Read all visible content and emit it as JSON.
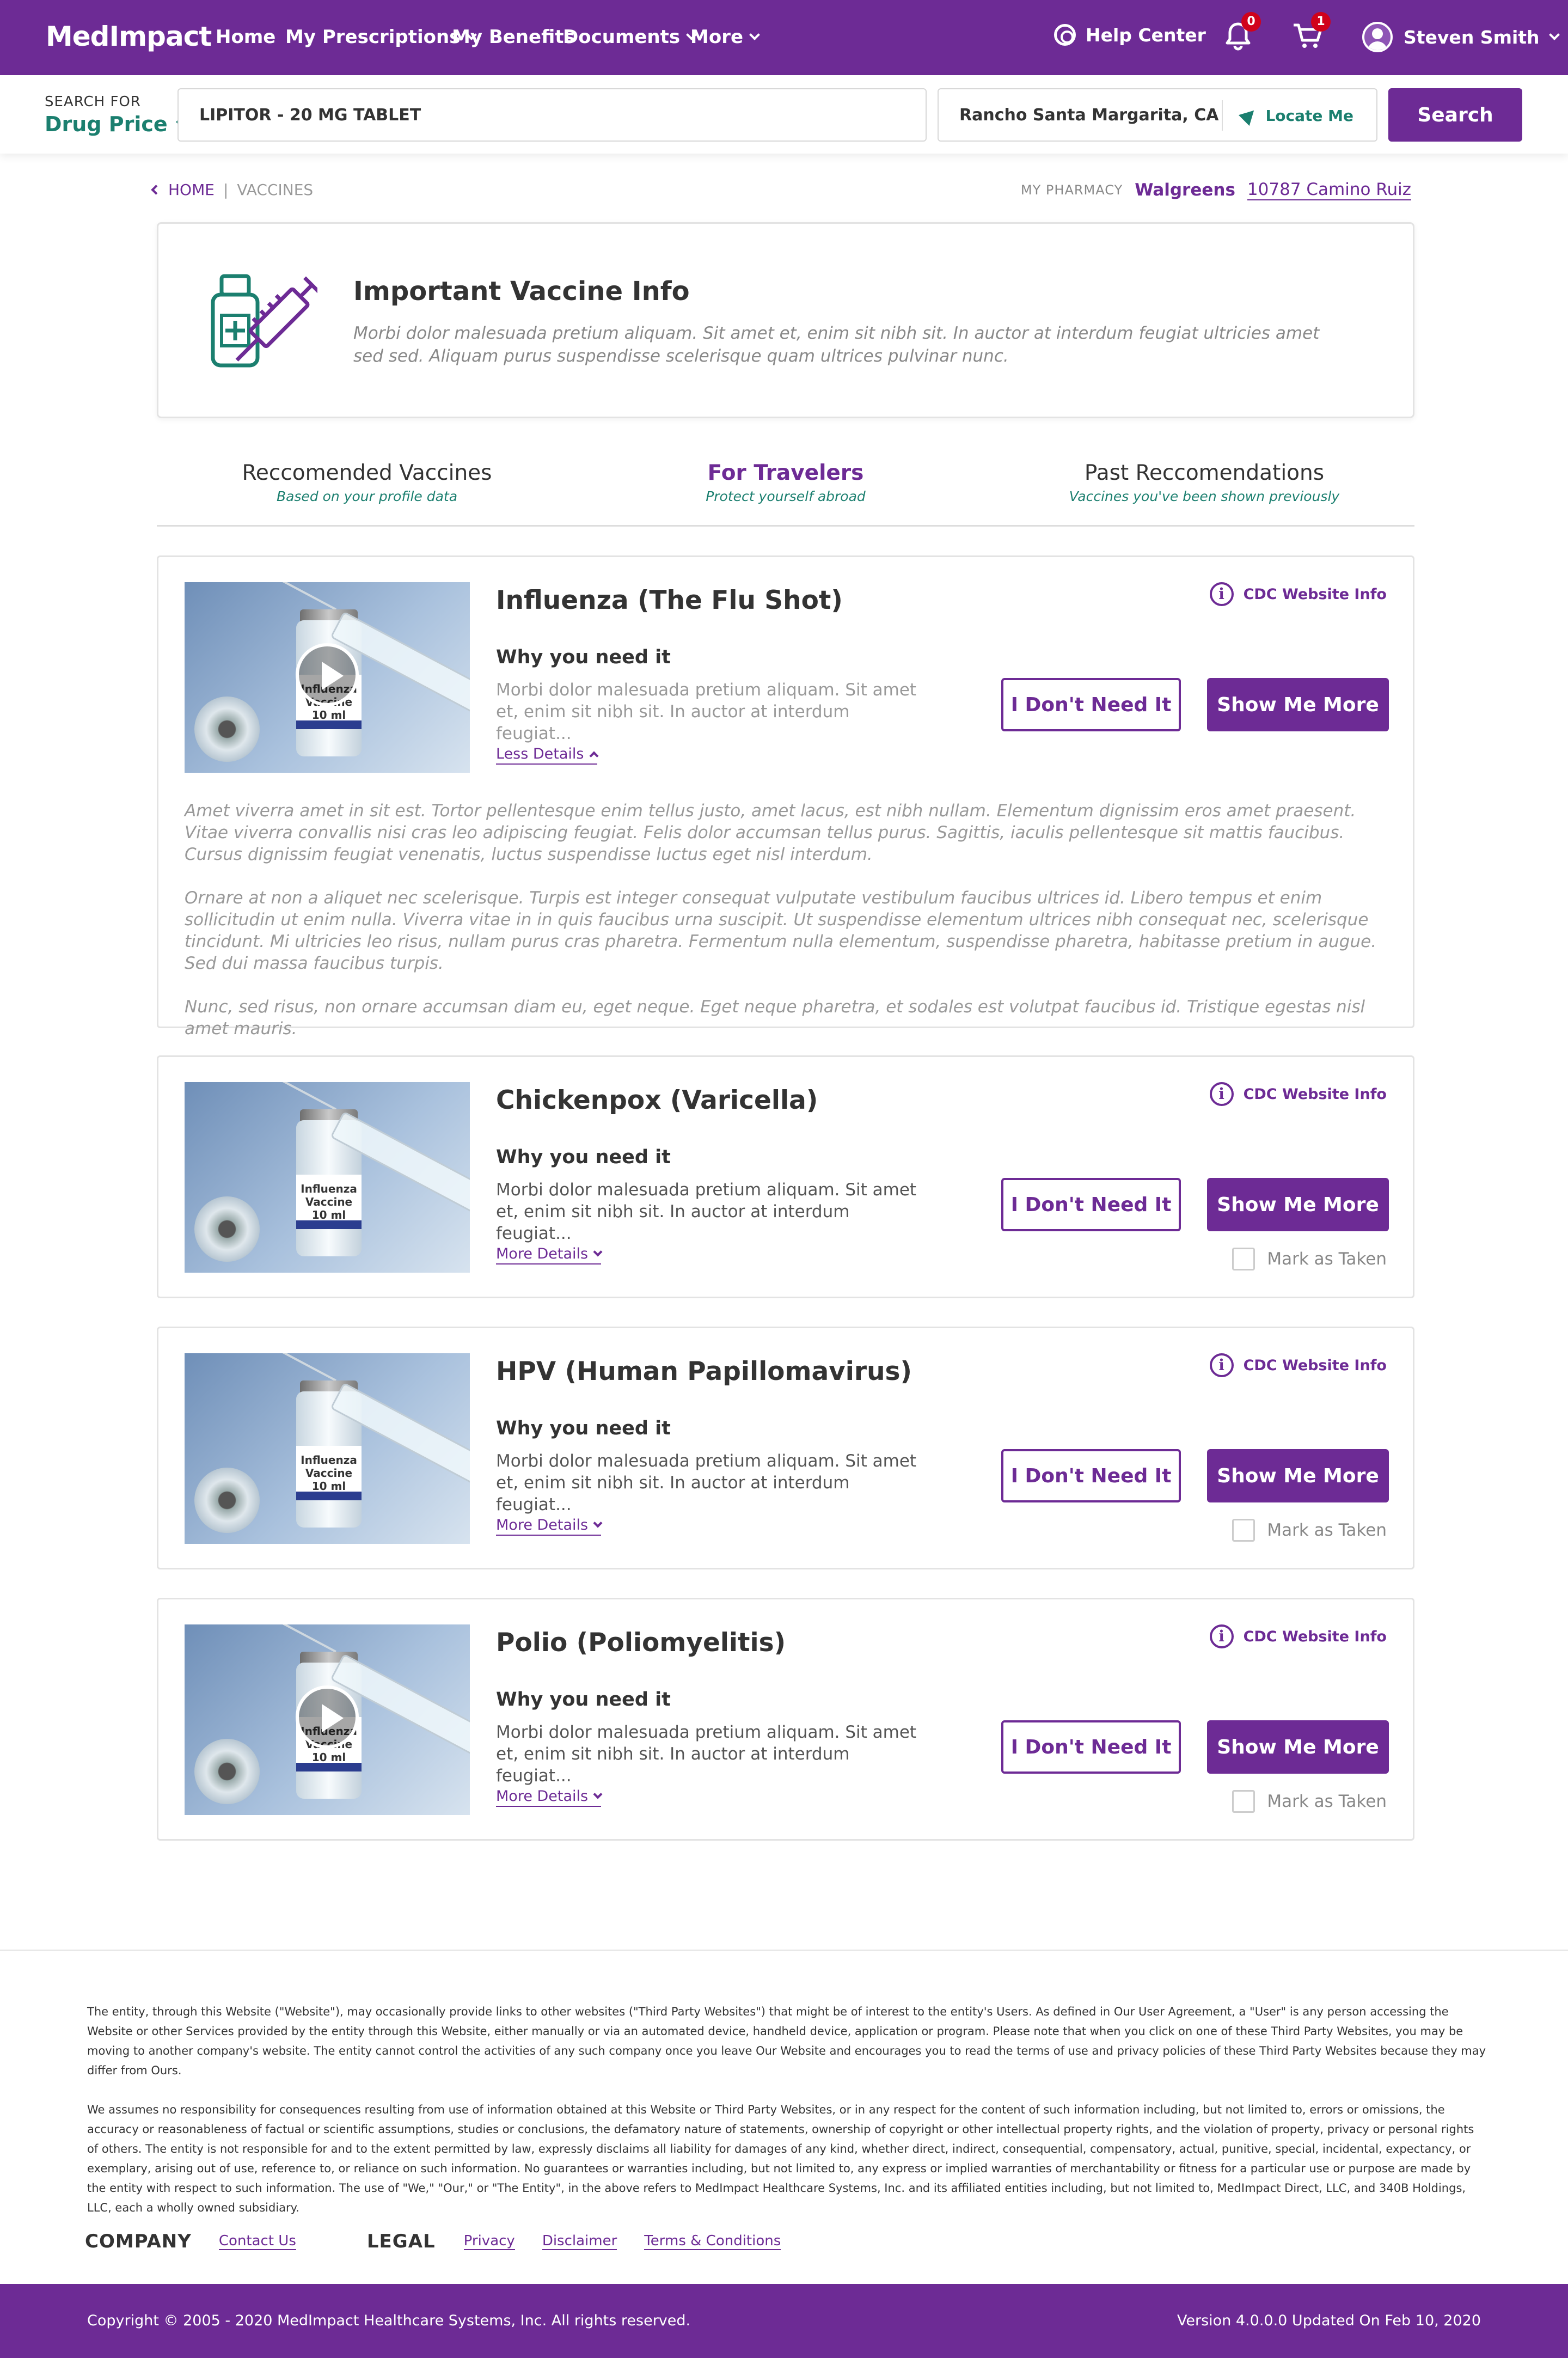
{
  "nav": {
    "logo": "MedImpact",
    "links": [
      "Home",
      "My Prescriptions",
      "My Benefits",
      "Documents",
      "More"
    ],
    "help": "Help Center",
    "notifications_count": "0",
    "cart_count": "1",
    "user": "Steven Smith",
    "brand_color": "#6d2b95"
  },
  "search": {
    "for_label": "SEARCH FOR",
    "for_value": "Drug Price",
    "drug": "LIPITOR - 20 MG TABLET",
    "location": "Rancho Santa Margarita, CA",
    "locate": "Locate Me",
    "button": "Search"
  },
  "breadcrumb": {
    "home": "HOME",
    "current": "VACCINES"
  },
  "pharmacy": {
    "label": "MY PHARMACY",
    "name": "Walgreens",
    "address": "10787 Camino Ruiz"
  },
  "info": {
    "title": "Important Vaccine Info",
    "text": "Morbi dolor malesuada pretium aliquam. Sit amet et, enim sit nibh sit. In auctor at interdum feugiat ultricies amet sed sed. Aliquam purus suspendisse scelerisque quam ultrices pulvinar nunc."
  },
  "tabs": [
    {
      "title": "Reccomended Vaccines",
      "subtitle": "Based on your profile data"
    },
    {
      "title": "For Travelers",
      "subtitle": "Protect yourself abroad"
    },
    {
      "title": "Past Reccomendations",
      "subtitle": "Vaccines you've been shown previously"
    }
  ],
  "common": {
    "why": "Why you need it",
    "desc": "Morbi dolor malesuada pretium aliquam. Sit amet et, enim sit nibh sit. In auctor at interdum feugiat...",
    "cdc": "CDC Website Info",
    "dont": "I Don't Need It",
    "more": "Show Me More",
    "taken": "Mark as Taken",
    "more_details": "More Details",
    "less_details": "Less Details",
    "vial_label": "Influenza Vaccine",
    "vial_ml": "10 ml"
  },
  "vaccines": [
    {
      "name": "Influenza (The Flu Shot)",
      "expanded": [
        "Amet viverra amet in sit est. Tortor pellentesque enim tellus justo, amet lacus, est nibh nullam. Elementum dignissim eros amet praesent. Vitae viverra convallis nisi cras leo adipiscing feugiat. Felis dolor accumsan tellus purus. Sagittis, iaculis pellentesque sit mattis faucibus. Cursus dignissim feugiat venenatis, luctus suspendisse luctus eget nisl interdum.",
        "Ornare at non a aliquet nec scelerisque. Turpis est integer consequat vulputate vestibulum faucibus ultrices id. Libero tempus et enim sollicitudin ut enim nulla. Viverra vitae in in quis faucibus urna suscipit. Ut suspendisse elementum ultrices nibh consequat nec, scelerisque tincidunt. Mi ultricies leo risus, nullam purus cras pharetra. Fermentum nulla elementum, suspendisse pharetra, habitasse pretium in augue. Sed dui massa faucibus turpis.",
        "Nunc, sed risus, non ornare accumsan diam eu, eget neque. Eget neque pharetra, et sodales est volutpat faucibus id. Tristique egestas nisl amet mauris."
      ]
    },
    {
      "name": "Chickenpox (Varicella)"
    },
    {
      "name": "HPV (Human Papillomavirus)"
    },
    {
      "name": "Polio (Poliomyelitis)"
    }
  ],
  "footer": {
    "disclaimer1": "The entity, through this Website (\"Website\"), may occasionally provide links to other websites (\"Third Party Websites\") that might be of interest to the entity's Users. As defined in Our User Agreement, a \"User\" is any person accessing the Website or other Services provided by the entity through this Website, either manually or via an automated device, handheld device, application or program. Please note that when you click on one of these Third Party Websites, you may be moving to another company's website. The entity cannot control the activities of any such company once you leave Our Website and encourages you to read the terms of use and privacy policies of these Third Party Websites because they may differ from Ours.",
    "disclaimer2": "We assumes no responsibility for consequences resulting from use of information obtained at this Website or Third Party Websites, or in any respect for the content of such information including, but not limited to, errors or omissions, the accuracy or reasonableness of factual or scientific assumptions, studies or conclusions, the defamatory nature of statements, ownership of copyright or other intellectual property rights, and the violation of property, privacy or personal rights of others. The entity is not responsible for and to the extent permitted by law, expressly disclaims all liability for damages of any kind, whether direct, indirect, consequential, compensatory, actual, punitive, special, incidental, expectancy, or exemplary, arising out of use, reference to, or reliance on such information. No guarantees or warranties including, but not limited to, any express or implied warranties of merchantability or fitness for a particular use or purpose are made by the entity with respect to such information. The use of \"We,\" \"Our,\" or \"The Entity\", in the above refers to MedImpact Healthcare Systems, Inc. and its affiliated entities including, but not limited to, MedImpact Direct, LLC, and 340B Holdings, LLC, each a wholly owned subsidiary.",
    "company": "COMPANY",
    "contact": "Contact Us",
    "legal": "LEGAL",
    "privacy": "Privacy",
    "disclaimer_link": "Disclaimer",
    "terms": "Terms & Conditions",
    "copyright": "Copyright © 2005 - 2020 MedImpact Healthcare Systems, Inc. All rights reserved.",
    "version": "Version 4.0.0.0    Updated On Feb 10, 2020"
  }
}
